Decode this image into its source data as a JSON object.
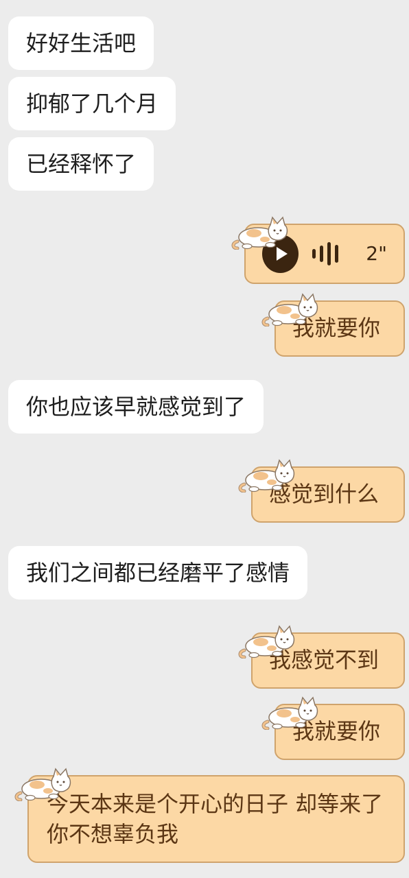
{
  "theme": {
    "background": "#ececec",
    "incoming_bubble": "#ffffff",
    "outgoing_bubble": "#fcd8a5",
    "outgoing_border": "#cfa36c",
    "outgoing_text": "#5b3614"
  },
  "messages": [
    {
      "side": "incoming",
      "text": "好好生活吧"
    },
    {
      "side": "incoming",
      "text": "抑郁了几个月"
    },
    {
      "side": "incoming",
      "text": "已经释怀了"
    },
    {
      "side": "outgoing",
      "type": "voice",
      "duration": "2\"",
      "icon": "play-icon"
    },
    {
      "side": "outgoing",
      "text": "我就要你"
    },
    {
      "side": "incoming",
      "text": "你也应该早就感觉到了"
    },
    {
      "side": "outgoing",
      "text": "感觉到什么"
    },
    {
      "side": "incoming",
      "text": "我们之间都已经磨平了感情"
    },
    {
      "side": "outgoing",
      "text": "我感觉不到"
    },
    {
      "side": "outgoing",
      "text": "我就要你"
    },
    {
      "side": "outgoing",
      "text": "今天本来是个开心的日子 却等来了你不想辜负我"
    }
  ]
}
